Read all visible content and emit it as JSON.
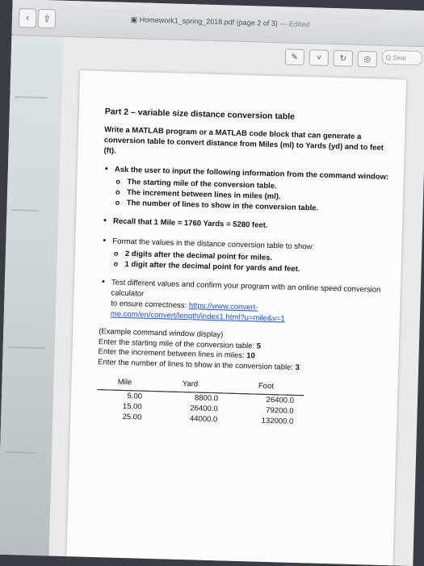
{
  "window": {
    "title": "Homework1_spring_2018.pdf (page 2 of 3)",
    "edited_suffix": "— Edited"
  },
  "toolbar": {
    "search_placeholder": "Q Sear"
  },
  "document": {
    "section_title": "Part 2 – variable size distance conversion table",
    "intro": "Write a MATLAB program or a MATLAB code block that can generate a conversion table to convert distance from Miles (ml) to Yards (yd) and to feet (ft).",
    "ask_bullet": "Ask the user to input the following information from the command window:",
    "ask_items": [
      "The starting mile of the conversion table.",
      "The increment between lines in miles (ml).",
      "The number of lines to show in the conversion table."
    ],
    "recall": "Recall that 1 Mile = 1760 Yards = 5280 feet.",
    "format_bullet": "Format the values in the distance conversion table to show:",
    "format_items": [
      "2 digits after the decimal point for miles.",
      "1 digit after the decimal point for yards and feet."
    ],
    "test_line1": "Test different values and confirm your program with an online speed conversion calculator",
    "test_line2_prefix": "to ensure correctness: ",
    "test_link": "https://www.convert-me.com/en/convert/length/index1.html?u=mile&v=1",
    "example": {
      "title": "(Example command window display)",
      "prompt1": "Enter the starting mile of the conversion table: ",
      "value1": "5",
      "prompt2": "Enter the increment between lines in miles: ",
      "value2": "10",
      "prompt3": "Enter the number of lines to show in the conversion table: ",
      "value3": "3"
    },
    "table": {
      "headers": [
        "Mile",
        "Yard",
        "Foot"
      ],
      "rows": [
        [
          "5.00",
          "8800.0",
          "26400.0"
        ],
        [
          "15.00",
          "26400.0",
          "79200.0"
        ],
        [
          "25.00",
          "44000.0",
          "132000.0"
        ]
      ]
    }
  }
}
